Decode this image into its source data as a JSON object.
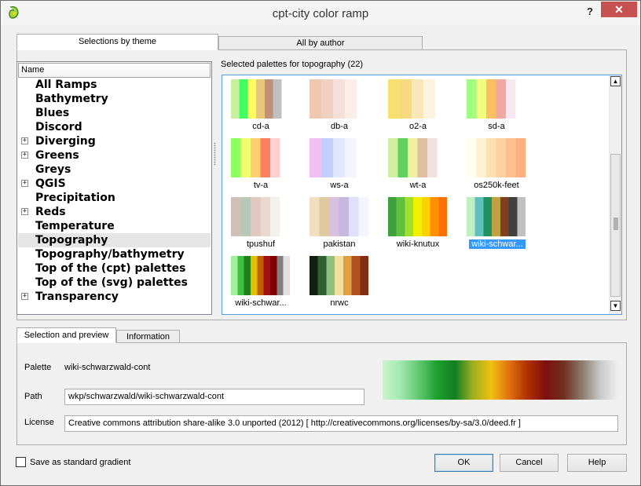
{
  "window": {
    "title": "cpt-city color ramp",
    "help_icon": "question-mark",
    "close_icon": "x"
  },
  "tabs": [
    "Selections by theme",
    "All by author"
  ],
  "tree": {
    "header": "Name",
    "items": [
      {
        "label": "All Ramps",
        "expandable": false
      },
      {
        "label": "Bathymetry",
        "expandable": false
      },
      {
        "label": "Blues",
        "expandable": false
      },
      {
        "label": "Discord",
        "expandable": false
      },
      {
        "label": "Diverging",
        "expandable": true
      },
      {
        "label": "Greens",
        "expandable": true
      },
      {
        "label": "Greys",
        "expandable": false
      },
      {
        "label": "QGIS",
        "expandable": true
      },
      {
        "label": "Precipitation",
        "expandable": false
      },
      {
        "label": "Reds",
        "expandable": true
      },
      {
        "label": "Temperature",
        "expandable": false
      },
      {
        "label": "Topography",
        "expandable": false,
        "selected": true
      },
      {
        "label": "Topography/bathymetry",
        "expandable": false
      },
      {
        "label": "Top of the (cpt) palettes",
        "expandable": false
      },
      {
        "label": "Top of the (svg) palettes",
        "expandable": false
      },
      {
        "label": "Transparency",
        "expandable": true
      }
    ]
  },
  "palettes": {
    "caption": "Selected palettes for topography (22)",
    "items": [
      {
        "label": "cd-a",
        "colors": [
          "#c8f0a0",
          "#40ff60",
          "#ffff60",
          "#e8c878",
          "#c09078",
          "#c0c0c0",
          "#ffffff"
        ]
      },
      {
        "label": "db-a",
        "colors": [
          "#f0c8b0",
          "#f0d0c0",
          "#f4e0d8",
          "#faeeea",
          "#ffffff"
        ]
      },
      {
        "label": "o2-a",
        "colors": [
          "#f8e070",
          "#f8d880",
          "#f8e8b8",
          "#fcf4e0",
          "#ffffff"
        ]
      },
      {
        "label": "sd-a",
        "colors": [
          "#a0ff80",
          "#f0ff80",
          "#f8c060",
          "#f0a8a0",
          "#f8e8f0",
          "#ffffff"
        ]
      },
      {
        "label": "tv-a",
        "colors": [
          "#90ff60",
          "#f0ff70",
          "#ffd070",
          "#ff8060",
          "#ffd0d0",
          "#ffffff"
        ]
      },
      {
        "label": "ws-a",
        "colors": [
          "#f0c0f0",
          "#c0d0ff",
          "#e0e8ff",
          "#f4f4ff",
          "#ffffff"
        ]
      },
      {
        "label": "wt-a",
        "colors": [
          "#d0f0a0",
          "#60d060",
          "#f0f0a0",
          "#e0c0a0",
          "#f0e0e0",
          "#ffffff"
        ]
      },
      {
        "label": "os250k-feet",
        "colors": [
          "#fffff0",
          "#fff0d0",
          "#ffe0b0",
          "#ffd0a0",
          "#ffc090",
          "#ffb080"
        ]
      },
      {
        "label": "tpushuf",
        "colors": [
          "#d0c0b8",
          "#b8c8b8",
          "#e0c8c0",
          "#e8d8d0",
          "#f4f0ec",
          "#ffffff"
        ]
      },
      {
        "label": "pakistan",
        "colors": [
          "#f0e0c0",
          "#e0c8a0",
          "#d8c0e0",
          "#c8b8e0",
          "#e0e0f8",
          "#f4f4ff"
        ]
      },
      {
        "label": "wiki-knutux",
        "colors": [
          "#40a040",
          "#60c040",
          "#a0e030",
          "#f0f000",
          "#ffd000",
          "#ff9000",
          "#ff7000"
        ]
      },
      {
        "label": "wiki-schwar...",
        "colors": [
          "#c0f0c0",
          "#60c0c0",
          "#209060",
          "#c0a040",
          "#804020",
          "#404040",
          "#c0c0c0"
        ],
        "selected": true
      },
      {
        "label": "wiki-schwar...",
        "colors": [
          "#a0f0a0",
          "#40c040",
          "#208020",
          "#e0c000",
          "#c06000",
          "#a01010",
          "#800000",
          "#808080",
          "#e0e0e0"
        ]
      },
      {
        "label": "nrwc",
        "colors": [
          "#102010",
          "#306030",
          "#90c080",
          "#f0e0a0",
          "#e0a040",
          "#b05020",
          "#803010"
        ]
      }
    ]
  },
  "bottom_tabs": [
    "Selection and preview",
    "Information"
  ],
  "details": {
    "palette_label": "Palette",
    "palette_value": "wiki-schwarzwald-cont",
    "path_label": "Path",
    "path_value": "wkp/schwarzwald/wiki-schwarzwald-cont",
    "license_label": "License",
    "license_value": "Creative commons attribution share-alike 3.0 unported (2012)  [ http://creativecommons.org/licenses/by-sa/3.0/deed.fr ]",
    "preview_colors": [
      "#c8f5c8",
      "#a0e8b0",
      "#60c870",
      "#20a030",
      "#108020",
      "#a0b020",
      "#f0c010",
      "#e07010",
      "#b03000",
      "#801010",
      "#703020",
      "#8a7a6a",
      "#c8c8c8",
      "#f0f0f0"
    ]
  },
  "footer": {
    "save_std_label": "Save as standard gradient",
    "ok_label": "OK",
    "cancel_label": "Cancel",
    "help_label": "Help"
  }
}
